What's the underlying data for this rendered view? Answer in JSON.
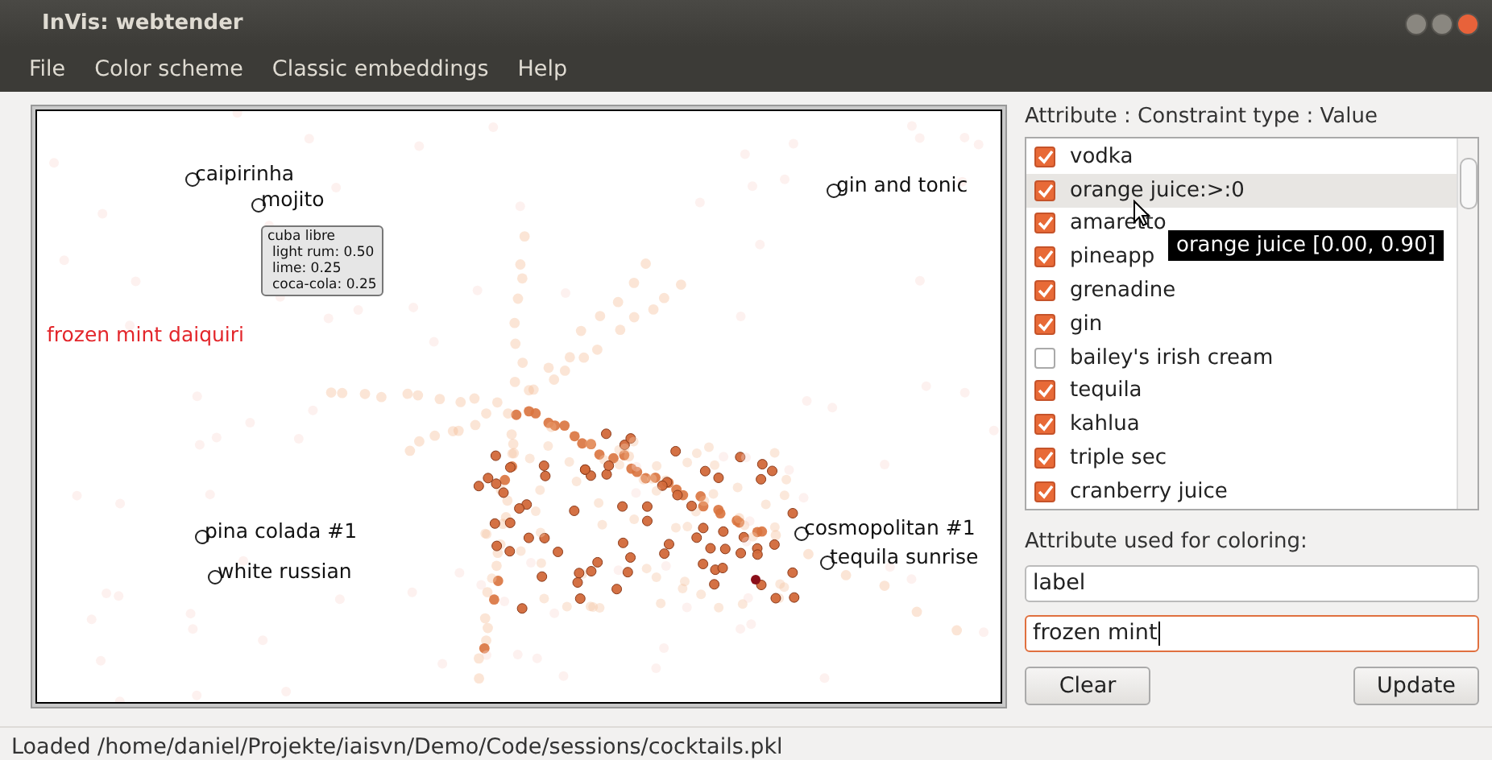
{
  "window": {
    "title": "InVis: webtender"
  },
  "menu": [
    "File",
    "Color scheme",
    "Classic embeddings",
    "Help"
  ],
  "plot": {
    "labels": [
      {
        "text": "caipirinha",
        "highlighted": false,
        "marker": true
      },
      {
        "text": "mojito",
        "highlighted": false,
        "marker": true
      },
      {
        "text": "gin and tonic",
        "highlighted": false,
        "marker": true
      },
      {
        "text": "frozen mint daiquiri",
        "highlighted": true,
        "marker": false
      },
      {
        "text": "pina colada #1",
        "highlighted": false,
        "marker": true
      },
      {
        "text": "white russian",
        "highlighted": false,
        "marker": true
      },
      {
        "text": "cosmopolitan #1",
        "highlighted": false,
        "marker": true
      },
      {
        "text": "tequila sunrise",
        "highlighted": false,
        "marker": true
      }
    ],
    "tooltip": {
      "title": "cuba libre",
      "lines": [
        "light rum: 0.50",
        "lime: 0.25",
        "coca-cola: 0.25"
      ]
    }
  },
  "constraints": {
    "heading": "Attribute : Constraint type : Value",
    "items": [
      {
        "label": "vodka",
        "checked": true,
        "selected": false
      },
      {
        "label": "orange juice:>:0",
        "checked": true,
        "selected": true
      },
      {
        "label": "amaretto",
        "checked": true,
        "selected": false
      },
      {
        "label": "pineapp",
        "checked": true,
        "selected": false
      },
      {
        "label": "grenadine",
        "checked": true,
        "selected": false
      },
      {
        "label": "gin",
        "checked": true,
        "selected": false
      },
      {
        "label": "bailey's irish cream",
        "checked": false,
        "selected": false
      },
      {
        "label": "tequila",
        "checked": true,
        "selected": false
      },
      {
        "label": "kahlua",
        "checked": true,
        "selected": false
      },
      {
        "label": "triple sec",
        "checked": true,
        "selected": false
      },
      {
        "label": "cranberry juice",
        "checked": true,
        "selected": false
      }
    ],
    "tooltip": "orange juice [0.00, 0.90]"
  },
  "coloring": {
    "heading": "Attribute used for coloring:",
    "fields": [
      {
        "value": "label",
        "focused": false
      },
      {
        "value": "frozen mint",
        "focused": true
      }
    ]
  },
  "buttons": [
    "Clear",
    "Update"
  ],
  "status_bar": "Loaded /home/daniel/Projekte/iaisvn/Demo/Code/sessions/cocktails.pkl"
}
